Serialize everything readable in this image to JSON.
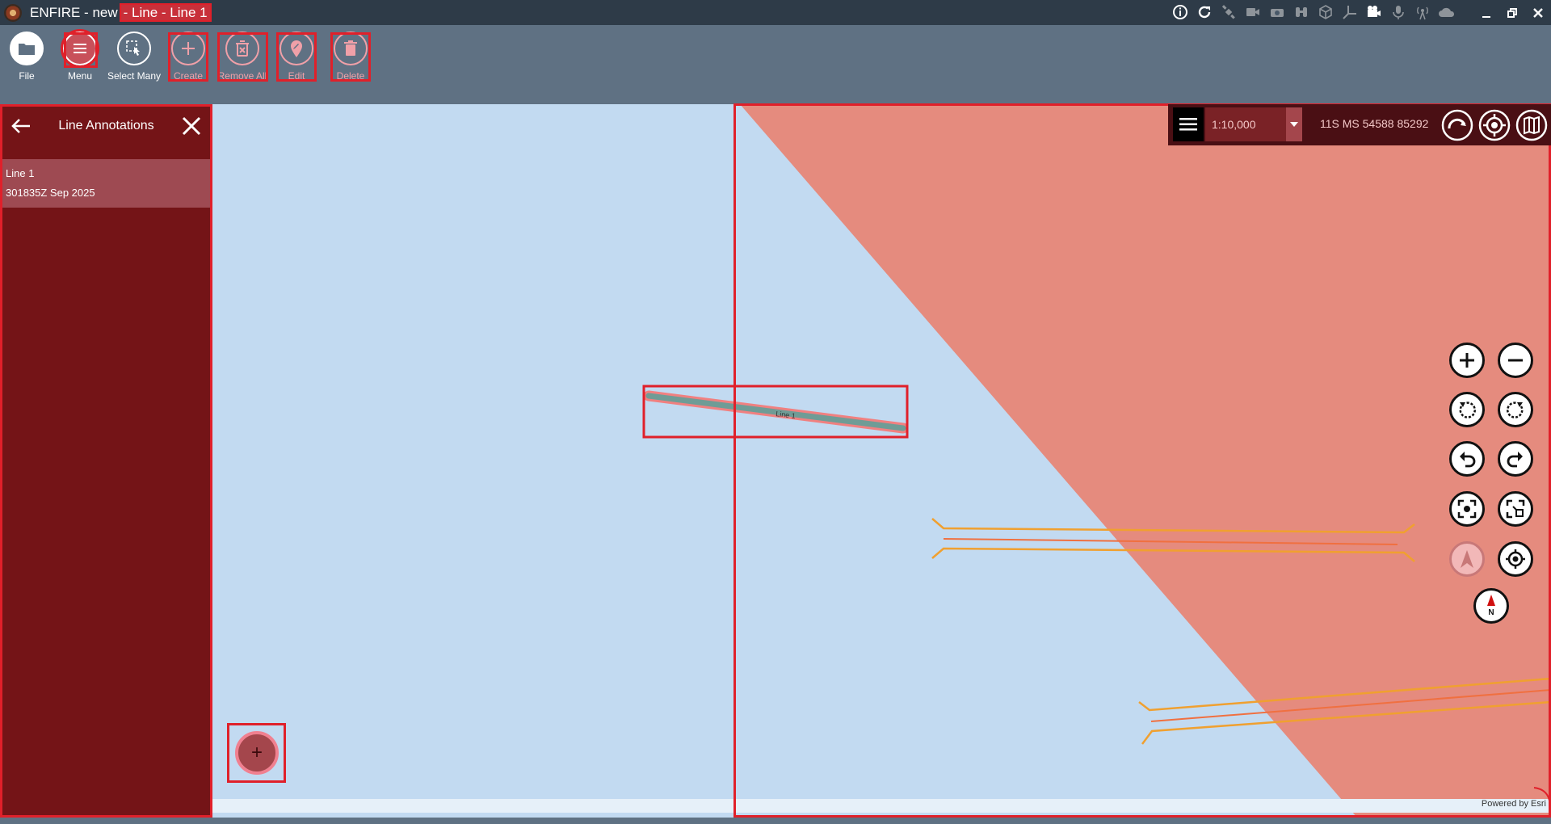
{
  "titlebar": {
    "app": "ENFIRE - new",
    "context": "- Line - Line 1",
    "icons": [
      "info-icon",
      "refresh-icon",
      "satellite-icon",
      "video-icon",
      "camera-icon",
      "binoculars-icon",
      "cube-icon",
      "axis-icon",
      "film-icon",
      "microphone-icon",
      "antenna-icon",
      "cloud-icon"
    ],
    "window_controls": [
      "minimize",
      "restore",
      "close"
    ]
  },
  "toolbar": {
    "file": "File",
    "menu": "Menu",
    "select_many": "Select Many",
    "create": "Create",
    "remove_all": "Remove All",
    "edit": "Edit",
    "delete": "Delete"
  },
  "panel": {
    "title": "Line Annotations",
    "items": [
      {
        "name": "Line 1",
        "dtg": "301835Z Sep 2025"
      }
    ]
  },
  "map": {
    "scale": "1:10,000",
    "coordinate": "11S MS 54588 85292",
    "line_label": "Line 1",
    "attribution": "Powered by Esri",
    "fab_label": "+",
    "north_label": "N",
    "colors": {
      "water": "#c2daf1",
      "land": "#e58b7e",
      "selection": "#e0202a",
      "panel": "#741417",
      "road": "#f0a030"
    }
  }
}
